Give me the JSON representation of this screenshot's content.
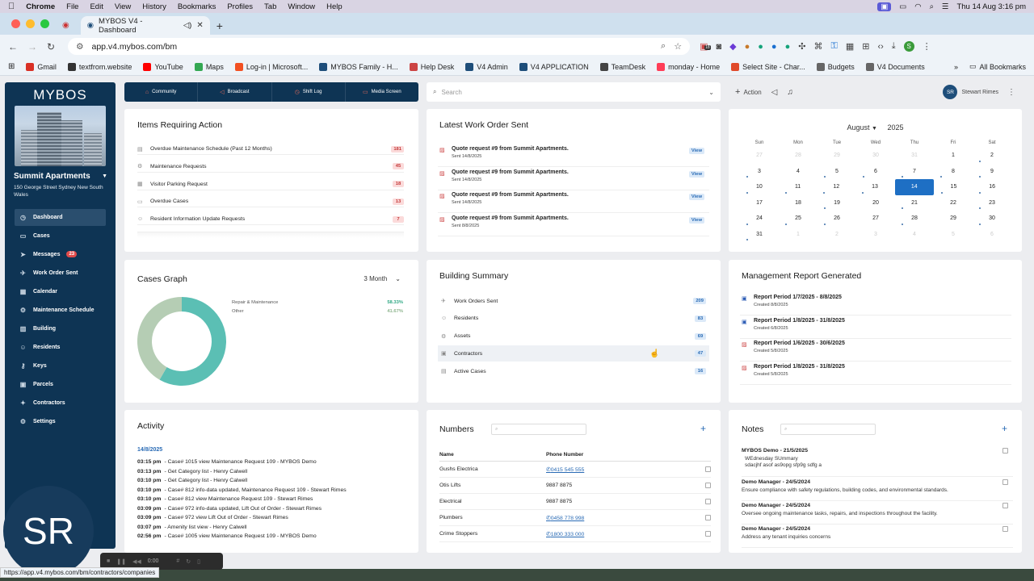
{
  "os_menu": {
    "app": "Chrome",
    "items": [
      "File",
      "Edit",
      "View",
      "History",
      "Bookmarks",
      "Profiles",
      "Tab",
      "Window",
      "Help"
    ],
    "clock": "Thu 14 Aug  3:16 pm"
  },
  "browser": {
    "tab_title": "MYBOS V4 - Dashboard",
    "url": "app.v4.mybos.com/bm",
    "ext_badge": "18",
    "profile_initial": "S",
    "bookmarks": [
      {
        "label": "Gmail",
        "color": "#d93025"
      },
      {
        "label": "textfrom.website",
        "color": "#333"
      },
      {
        "label": "YouTube",
        "color": "#ff0000"
      },
      {
        "label": "Maps",
        "color": "#34a853"
      },
      {
        "label": "Log-in | Microsoft...",
        "color": "#f25022"
      },
      {
        "label": "MYBOS Family - H...",
        "color": "#1e4e7a"
      },
      {
        "label": "Help Desk",
        "color": "#c44"
      },
      {
        "label": "V4 Admin",
        "color": "#1e4e7a"
      },
      {
        "label": "V4 APPLICATION",
        "color": "#1e4e7a"
      },
      {
        "label": "TeamDesk",
        "color": "#444"
      },
      {
        "label": "monday - Home",
        "color": "#ff3d57"
      },
      {
        "label": "Select Site - Char...",
        "color": "#e04a2b"
      },
      {
        "label": "Budgets",
        "color": "#666"
      },
      {
        "label": "V4 Documents",
        "color": "#666"
      }
    ],
    "all_bookmarks": "All Bookmarks",
    "status_url": "https://app.v4.mybos.com/bm/contractors/companies"
  },
  "sidebar": {
    "logo": "MYBOS",
    "building_name": "Summit Apartments",
    "building_address": "150 George Street Sydney New South Wales",
    "items": [
      {
        "label": "Dashboard",
        "icon": "◷",
        "active": true
      },
      {
        "label": "Cases",
        "icon": "▭"
      },
      {
        "label": "Messages",
        "icon": "➤",
        "badge": "23"
      },
      {
        "label": "Work Order Sent",
        "icon": "✈"
      },
      {
        "label": "Calendar",
        "icon": "▦"
      },
      {
        "label": "Maintenance Schedule",
        "icon": "⚙"
      },
      {
        "label": "Building",
        "icon": "▥"
      },
      {
        "label": "Residents",
        "icon": "☺"
      },
      {
        "label": "Keys",
        "icon": "⚷"
      },
      {
        "label": "Parcels",
        "icon": "▣"
      },
      {
        "label": "Contractors",
        "icon": "✦"
      },
      {
        "label": "Settings",
        "icon": "⚙"
      }
    ]
  },
  "topnav": [
    "Community",
    "Broadcast",
    "Shift Log",
    "Media Screen"
  ],
  "search": {
    "placeholder": "Search"
  },
  "actionbar": {
    "action": "Action",
    "user_initials": "SR",
    "user_name": "Stewart Rimes"
  },
  "items_requiring_action": {
    "title": "Items Requiring Action",
    "items": [
      {
        "label": "Overdue Maintenance Schedule (Past 12 Months)",
        "count": "181"
      },
      {
        "label": "Maintenance Requests",
        "count": "45"
      },
      {
        "label": "Visitor Parking Request",
        "count": "18"
      },
      {
        "label": "Overdue Cases",
        "count": "13"
      },
      {
        "label": "Resident Information Update Requests",
        "count": "7"
      }
    ]
  },
  "latest_work_order": {
    "title": "Latest Work Order Sent",
    "view_label": "View",
    "items": [
      {
        "title": "Quote request #9 from Summit Apartments.",
        "sent": "Sent 14/8/2025"
      },
      {
        "title": "Quote request #9 from Summit Apartments.",
        "sent": "Sent 14/8/2025"
      },
      {
        "title": "Quote request #9 from Summit Apartments.",
        "sent": "Sent 14/8/2025"
      },
      {
        "title": "Quote request #9 from Summit Apartments.",
        "sent": "Sent 8/8/2025"
      }
    ]
  },
  "calendar": {
    "month": "August",
    "year": "2025",
    "day_names": [
      "Sun",
      "Mon",
      "Tue",
      "Wed",
      "Thu",
      "Fri",
      "Sat"
    ],
    "weeks": [
      [
        {
          "d": "27",
          "m": 1
        },
        {
          "d": "28",
          "m": 1
        },
        {
          "d": "29",
          "m": 1
        },
        {
          "d": "30",
          "m": 1
        },
        {
          "d": "31",
          "m": 1
        },
        {
          "d": "1"
        },
        {
          "d": "2",
          "dot": 1
        }
      ],
      [
        {
          "d": "3",
          "dot": 1
        },
        {
          "d": "4"
        },
        {
          "d": "5",
          "dot": 1
        },
        {
          "d": "6",
          "dot": 1
        },
        {
          "d": "7",
          "dot": 1
        },
        {
          "d": "8",
          "dot": 1
        },
        {
          "d": "9",
          "dot": 1
        }
      ],
      [
        {
          "d": "10",
          "dot": 1
        },
        {
          "d": "11",
          "dot": 1
        },
        {
          "d": "12",
          "dot": 1
        },
        {
          "d": "13",
          "dot": 1
        },
        {
          "d": "14",
          "today": 1
        },
        {
          "d": "15",
          "dot": 1
        },
        {
          "d": "16",
          "dot": 1
        }
      ],
      [
        {
          "d": "17"
        },
        {
          "d": "18"
        },
        {
          "d": "19",
          "dot": 1
        },
        {
          "d": "20"
        },
        {
          "d": "21",
          "dot": 1
        },
        {
          "d": "22"
        },
        {
          "d": "23",
          "dot": 1
        }
      ],
      [
        {
          "d": "24",
          "dot": 1
        },
        {
          "d": "25",
          "dot": 1
        },
        {
          "d": "26",
          "dot": 1
        },
        {
          "d": "27"
        },
        {
          "d": "28",
          "dot": 1
        },
        {
          "d": "29"
        },
        {
          "d": "30",
          "dot": 1
        }
      ],
      [
        {
          "d": "31",
          "dot": 1
        },
        {
          "d": "1",
          "m": 1
        },
        {
          "d": "2",
          "m": 1
        },
        {
          "d": "3",
          "m": 1
        },
        {
          "d": "4",
          "m": 1
        },
        {
          "d": "5",
          "m": 1
        },
        {
          "d": "6",
          "m": 1
        }
      ]
    ]
  },
  "cases_graph": {
    "title": "Cases Graph",
    "period": "3 Month"
  },
  "chart_data": {
    "type": "pie",
    "categories": [
      "Repair & Maintenance",
      "Other"
    ],
    "values": [
      58.33,
      41.67
    ],
    "labels": [
      "58.33%",
      "41.67%"
    ],
    "colors": [
      "#5bbfb4",
      "#b5cdb4"
    ]
  },
  "building_summary": {
    "title": "Building Summary",
    "items": [
      {
        "label": "Work Orders Sent",
        "count": "209",
        "icon": "✈"
      },
      {
        "label": "Residents",
        "count": "83",
        "icon": "☺"
      },
      {
        "label": "Assets",
        "count": "69",
        "icon": "⚙"
      },
      {
        "label": "Contractors",
        "count": "47",
        "icon": "▣"
      },
      {
        "label": "Active Cases",
        "count": "16",
        "icon": "▤"
      }
    ]
  },
  "management_report": {
    "title": "Management Report Generated",
    "items": [
      {
        "title": "Report Period 1/7/2025 - 8/8/2025",
        "created": "Created 8/8/2025",
        "type": "word"
      },
      {
        "title": "Report Period 1/8/2025 - 31/8/2025",
        "created": "Created 6/8/2025",
        "type": "word"
      },
      {
        "title": "Report Period 1/6/2025 - 30/6/2025",
        "created": "Created 5/8/2025",
        "type": "pdf"
      },
      {
        "title": "Report Period 1/8/2025 - 31/8/2025",
        "created": "Created 5/8/2025",
        "type": "pdf"
      }
    ]
  },
  "activity": {
    "title": "Activity",
    "date": "14/8/2025",
    "items": [
      {
        "time": "03:15 pm",
        "text": "- Case# 1015 view Maintenance Request 109 - MYBOS Demo"
      },
      {
        "time": "03:13 pm",
        "text": "- Get Category list - Henry Calwell"
      },
      {
        "time": "03:10 pm",
        "text": "- Get Category list - Henry Calwell"
      },
      {
        "time": "03:10 pm",
        "text": "- Case# 812 info-data updated, Maintenance Request 109 - Stewart Rimes"
      },
      {
        "time": "03:10 pm",
        "text": "- Case# 812 view Maintenance Request 109 - Stewart Rimes"
      },
      {
        "time": "03:09 pm",
        "text": "- Case# 972 info-data updated, Lift Out of Order - Stewart Rimes"
      },
      {
        "time": "03:09 pm",
        "text": "- Case# 972 view Lift Out of Order - Stewart Rimes"
      },
      {
        "time": "03:07 pm",
        "text": "- Amenity list view - Henry Calwell"
      },
      {
        "time": "02:56 pm",
        "text": "- Case# 1005 view Maintenance Request 109 - MYBOS Demo"
      }
    ]
  },
  "numbers": {
    "title": "Numbers",
    "col_name": "Name",
    "col_phone": "Phone Number",
    "rows": [
      {
        "name": "Gushs Electrica",
        "phone": "0415 545 555",
        "link": true
      },
      {
        "name": "Otis Lifts",
        "phone": "9887 8875",
        "link": false
      },
      {
        "name": "Electrical",
        "phone": "9887 8875",
        "link": false
      },
      {
        "name": "Plumbers",
        "phone": "0458 778 998",
        "link": true
      },
      {
        "name": "Crime Stoppers",
        "phone": "1800 333 000",
        "link": true
      }
    ]
  },
  "notes": {
    "title": "Notes",
    "items": [
      {
        "title": "MYBOS Demo - 21/5/2025",
        "body": "WEdnesday SUmmary\nsdacjhf asof as9opg sfp9g sdfg a"
      },
      {
        "title": "Demo Manager - 24/5/2024",
        "body": "Ensure compliance with safety regulations, building codes, and environmental standards."
      },
      {
        "title": "Demo Manager - 24/5/2024",
        "body": "Oversee ongoing maintenance tasks, repairs, and inspections throughout the facility."
      },
      {
        "title": "Demo Manager - 24/5/2024",
        "body": "Address any tenant inquiries concerns"
      }
    ]
  },
  "recording": {
    "initials": "SR",
    "time": "0:00"
  }
}
